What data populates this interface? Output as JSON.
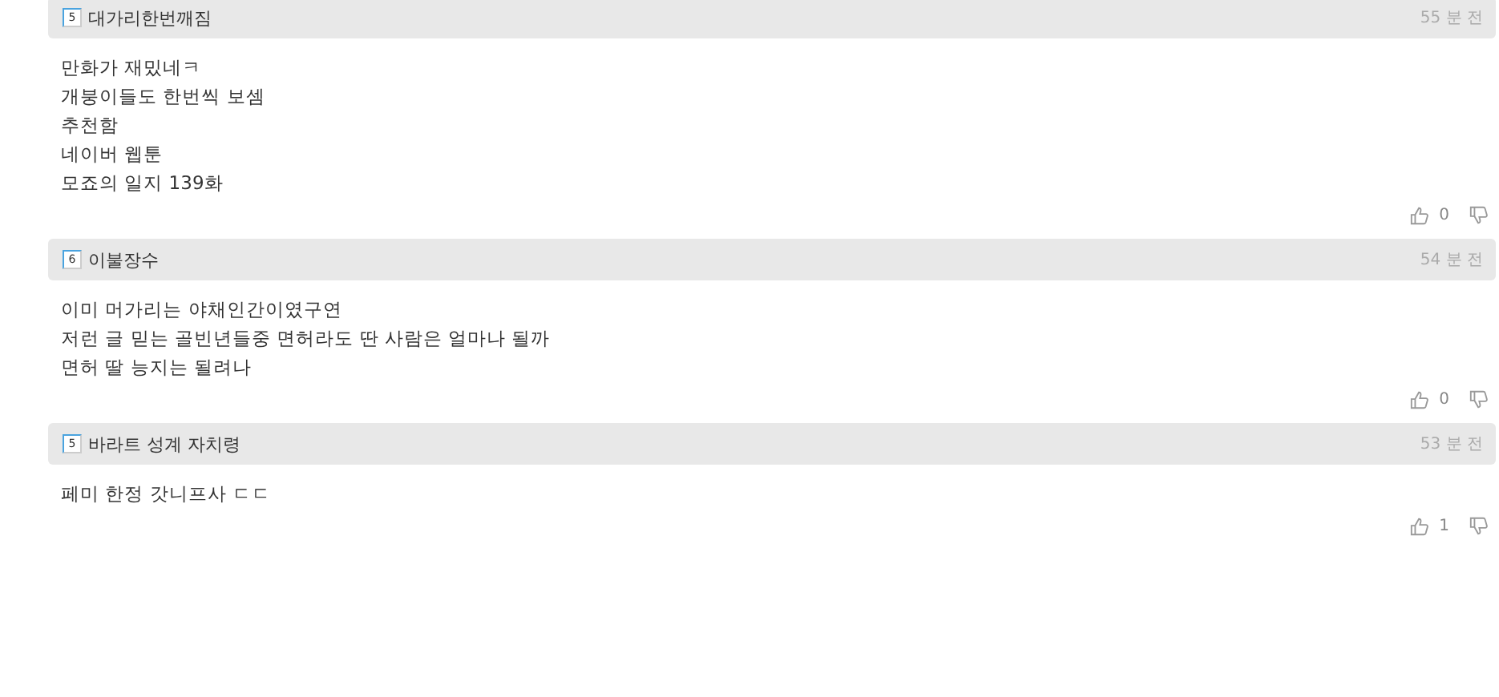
{
  "comments": [
    {
      "level_badge": "5",
      "author": "대가리한번깨짐",
      "time": "55 분 전",
      "lines": [
        "만화가 재밌네ㅋ",
        "개붕이들도 한번씩 보셈",
        "추천함",
        "네이버 웹툰",
        "모죠의 일지 139화"
      ],
      "likes": "0"
    },
    {
      "level_badge": "6",
      "author": "이불장수",
      "time": "54 분 전",
      "lines": [
        "이미 머가리는 야채인간이였구연",
        "저런 글 믿는 골빈년들중 면허라도 딴 사람은 얼마나 될까",
        "면허 딸 능지는 될려나"
      ],
      "likes": "0"
    },
    {
      "level_badge": "5",
      "author": "바라트 성계 자치령",
      "time": "53 분 전",
      "lines": [
        "페미 한정 갓니프사 ㄷㄷ"
      ],
      "likes": "1"
    }
  ]
}
